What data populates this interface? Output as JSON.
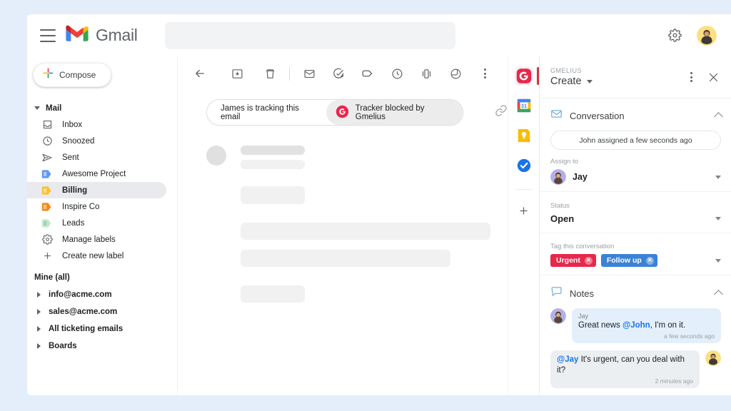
{
  "theme": {
    "page_bg": "#e4eefa",
    "card_bg": "#ffffff",
    "gmelius_red": "#e8274b",
    "urgent_tag": "#e8274b",
    "followup_tag": "#3b82d6",
    "selected_nav": "#e8eaed",
    "rail_indicator": "#d0353f"
  },
  "gmail": {
    "menu_icon": "hamburger-icon",
    "logo_name": "gmail-logo-icon",
    "wordmark": "Gmail",
    "search": {
      "value": "",
      "placeholder": ""
    },
    "settings_icon": "gear-icon",
    "account_avatar": "user-avatar"
  },
  "compose": {
    "label": "Compose",
    "icon": "plus-icon"
  },
  "sidebar": {
    "section": {
      "label": "Mail",
      "expanded": true
    },
    "items": [
      {
        "label": "Inbox",
        "icon": "inbox-icon",
        "selected": false
      },
      {
        "label": "Snoozed",
        "icon": "clock-icon",
        "selected": false
      },
      {
        "label": "Sent",
        "icon": "send-icon",
        "selected": false
      },
      {
        "label": "Awesome Project",
        "icon": "label-icon-blue",
        "selected": false
      },
      {
        "label": "Billing",
        "icon": "label-icon-yellow",
        "selected": true
      },
      {
        "label": "Inspire Co",
        "icon": "label-icon-orange",
        "selected": false
      },
      {
        "label": "Leads",
        "icon": "label-icon-green",
        "selected": false
      },
      {
        "label": "Manage labels",
        "icon": "gear-icon",
        "selected": false
      },
      {
        "label": "Create new label",
        "icon": "plus-icon",
        "selected": false
      }
    ],
    "shared_header": "Mine (all)",
    "shared_items": [
      {
        "label": "info@acme.com"
      },
      {
        "label": "sales@acme.com"
      },
      {
        "label": "All ticketing emails"
      },
      {
        "label": "Boards"
      }
    ]
  },
  "email_toolbar": {
    "items": [
      {
        "name": "back-icon"
      },
      {
        "name": "archive-icon"
      },
      {
        "name": "delete-icon"
      },
      {
        "name": "mark-unread-icon"
      },
      {
        "name": "add-task-icon"
      },
      {
        "name": "label-icon"
      },
      {
        "name": "snooze-icon"
      },
      {
        "name": "snippet-icon"
      },
      {
        "name": "gmelius-share-icon"
      },
      {
        "name": "more-options-icon"
      }
    ]
  },
  "tracker": {
    "left_text": "James is tracking this email",
    "right_text": "Tracker blocked by Gmelius",
    "badge_icon": "gmelius-icon",
    "link_icon": "link-icon"
  },
  "rail": {
    "items": [
      {
        "name": "gmelius-icon",
        "active": true
      },
      {
        "name": "google-calendar-icon",
        "active": false,
        "day": "31"
      },
      {
        "name": "google-keep-icon",
        "active": false
      },
      {
        "name": "google-tasks-icon",
        "active": false
      }
    ],
    "add_label": "+",
    "add_name": "add-addon-icon"
  },
  "gmelius": {
    "brand": "GMELIUS",
    "title": "Create",
    "title_caret": "chevron-down-icon",
    "more_icon": "more-options-icon",
    "close_icon": "close-icon",
    "conversation": {
      "section_title": "Conversation",
      "section_icon": "envelope-icon",
      "collapse_icon": "chevron-up-icon",
      "assigned_note": "John assigned a few seconds ago",
      "assign_label": "Assign to",
      "assign_value": "Jay",
      "assign_avatar": "jay-avatar",
      "status_label": "Status",
      "status_value": "Open",
      "tag_label": "Tag this conversation",
      "tags": [
        {
          "label": "Urgent",
          "color": "#e8274b"
        },
        {
          "label": "Follow up",
          "color": "#3b82d6"
        }
      ]
    },
    "notes": {
      "section_title": "Notes",
      "section_icon": "note-icon",
      "collapse_icon": "chevron-up-icon",
      "items": [
        {
          "direction": "in",
          "author": "Jay",
          "avatar": "jay-avatar",
          "mention": "@John",
          "text_before": "Great news ",
          "text_after": ", I'm on it.",
          "time": "a few seconds ago"
        },
        {
          "direction": "out",
          "author": "",
          "avatar": "john-avatar",
          "mention": "@Jay",
          "text_before": "",
          "text_after": " It's urgent, can you deal with it?",
          "time": "2 minutes ago"
        }
      ]
    }
  }
}
